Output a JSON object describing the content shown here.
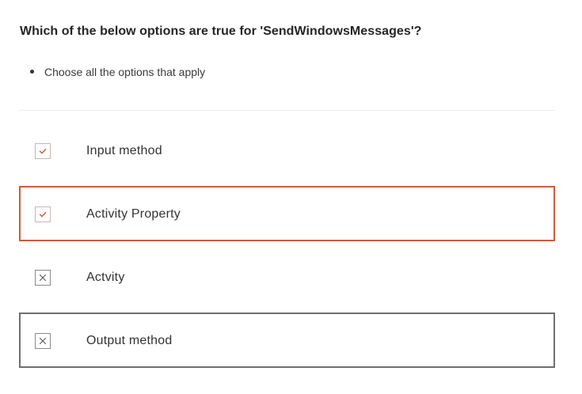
{
  "question": {
    "title": "Which of the below options are true for 'SendWindowsMessages'?"
  },
  "instructions": [
    "Choose all the options that apply"
  ],
  "colors": {
    "accent": "#e8512f",
    "focus_border": "#6e6e6e",
    "divider": "#ececec"
  },
  "options": [
    {
      "label": "Input method",
      "state": "checked",
      "icon": "checkmark-icon",
      "highlight": "none"
    },
    {
      "label": "Activity Property",
      "state": "checked",
      "icon": "checkmark-icon",
      "highlight": "selected"
    },
    {
      "label": "Actvity",
      "state": "crossed",
      "icon": "cross-icon",
      "highlight": "none"
    },
    {
      "label": "Output method",
      "state": "crossed",
      "icon": "cross-icon",
      "highlight": "focus"
    }
  ]
}
